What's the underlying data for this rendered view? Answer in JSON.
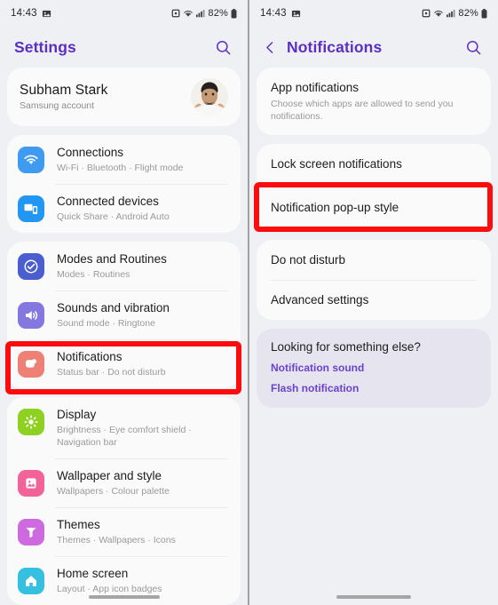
{
  "status_bar": {
    "time": "14:43",
    "left_icons": [
      "photo-icon"
    ],
    "right_icons": [
      "alarm-icon",
      "wifi-icon",
      "signal-icon"
    ],
    "battery": "82%"
  },
  "colors": {
    "accent": "#5b2ec4",
    "link": "#6b43cc",
    "highlight": "#fc0d0d",
    "page_bg": "#eff0f4",
    "card_bg": "#fafafa",
    "tint_card_bg": "#e6e4ef"
  },
  "left_panel": {
    "title": "Settings",
    "search_icon": "search-icon",
    "profile": {
      "name": "Subham Stark",
      "subtitle": "Samsung account",
      "avatar": "user-avatar"
    },
    "groups": [
      {
        "items": [
          {
            "title": "Connections",
            "subtitle": "Wi-Fi  ·  Bluetooth  ·  Flight mode",
            "icon": "wifi-icon",
            "icon_color": "#3e9bf0"
          },
          {
            "title": "Connected devices",
            "subtitle": "Quick Share  ·  Android Auto",
            "icon": "connected-devices-icon",
            "icon_color": "#2196f3"
          }
        ]
      },
      {
        "items": [
          {
            "title": "Modes and Routines",
            "subtitle": "Modes  ·  Routines",
            "icon": "modes-routines-icon",
            "icon_color": "#4a5ed0"
          },
          {
            "title": "Sounds and vibration",
            "subtitle": "Sound mode  ·  Ringtone",
            "icon": "sound-icon",
            "icon_color": "#8577e0"
          },
          {
            "title": "Notifications",
            "subtitle": "Status bar  ·  Do not disturb",
            "icon": "notifications-icon",
            "icon_color": "#ef8076",
            "highlighted": true
          }
        ]
      },
      {
        "items": [
          {
            "title": "Display",
            "subtitle": "Brightness  ·  Eye comfort shield  ·  Navigation bar",
            "icon": "display-icon",
            "icon_color": "#8ed122"
          },
          {
            "title": "Wallpaper and style",
            "subtitle": "Wallpapers  ·  Colour palette",
            "icon": "wallpaper-icon",
            "icon_color": "#f2639a"
          },
          {
            "title": "Themes",
            "subtitle": "Themes  ·  Wallpapers  ·  Icons",
            "icon": "themes-icon",
            "icon_color": "#cd6ae0"
          },
          {
            "title": "Home screen",
            "subtitle": "Layout  ·  App icon badges",
            "icon": "home-screen-icon",
            "icon_color": "#35c0e0"
          }
        ]
      }
    ]
  },
  "right_panel": {
    "title": "Notifications",
    "back_icon": "chevron-left-icon",
    "search_icon": "search-icon",
    "groups": [
      {
        "items": [
          {
            "title": "App notifications",
            "subtitle": "Choose which apps are allowed to send you notifications."
          }
        ]
      },
      {
        "items": [
          {
            "title": "Lock screen notifications",
            "subtitle": ""
          },
          {
            "title": "Notification pop-up style",
            "subtitle": "",
            "highlighted": true
          }
        ]
      },
      {
        "items": [
          {
            "title": "Do not disturb",
            "subtitle": ""
          },
          {
            "title": "Advanced settings",
            "subtitle": ""
          }
        ]
      }
    ],
    "looking_for": {
      "title": "Looking for something else?",
      "links": [
        "Notification sound",
        "Flash notification"
      ]
    }
  }
}
